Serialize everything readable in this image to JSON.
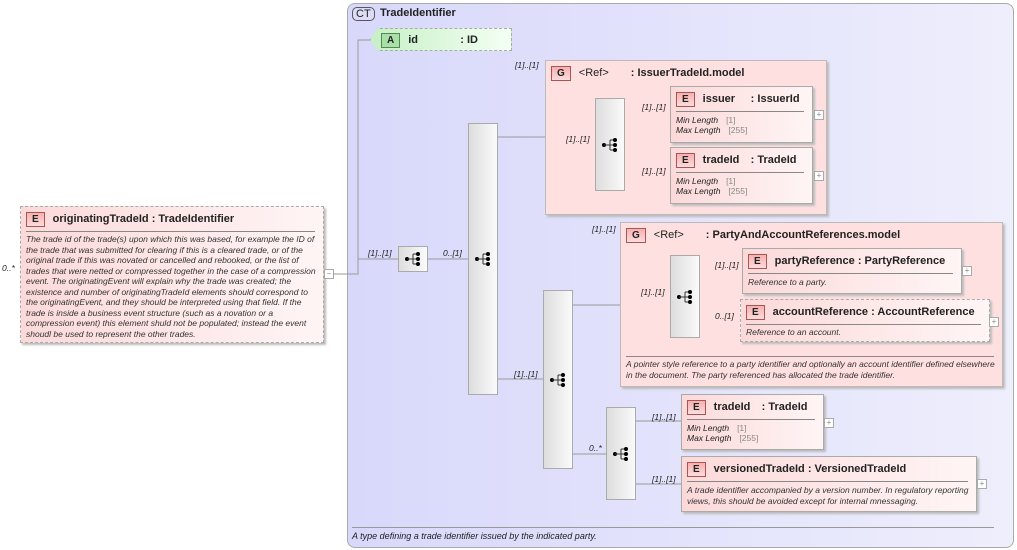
{
  "root": {
    "cardinality": "0..*",
    "badge": "E",
    "name": "originatingTradeId",
    "type": ": TradeIdentifier",
    "description": "The trade id of the trade(s) upon which this was based, for example the ID of the trade that was submitted for clearing if this is a cleared trade, or of the original trade if this was novated or cancelled and rebooked, or the list of trades that were netted or compressed together in the case of a compression event. The originatingEvent will explain why the trade was created; the existence and number of originatingTradeId elements should correspond to the originatingEvent, and they should be interpreted using that field. If the trade is inside a business event structure (such as a novation or a compression event) this element shuld not be populated; instead the event shoudl be used to represent the other trades."
  },
  "complex_type": {
    "badge": "CT",
    "name": "TradeIdentifier",
    "description": "A type defining a trade identifier issued by the indicated party."
  },
  "attribute": {
    "badge": "A",
    "name": "id",
    "type": ": ID"
  },
  "sequence_card": "[1]..[1]",
  "choice_card": "0..[1]",
  "issuer_group": {
    "card": "[1]..[1]",
    "badge": "G",
    "ref": "<Ref>",
    "name": ": IssuerTradeId.model",
    "seq_card": "[1]..[1]",
    "items": [
      {
        "card": "[1]..[1]",
        "badge": "E",
        "name": "issuer",
        "type": ": IssuerId",
        "facets": [
          [
            "Min Length",
            "[1]"
          ],
          [
            "Max Length",
            "[255]"
          ]
        ]
      },
      {
        "card": "[1]..[1]",
        "badge": "E",
        "name": "tradeId",
        "type": ": TradeId",
        "facets": [
          [
            "Min Length",
            "[1]"
          ],
          [
            "Max Length",
            "[255]"
          ]
        ]
      }
    ]
  },
  "seq2_card": "[1]..[1]",
  "party_group": {
    "card": "[1]..[1]",
    "badge": "G",
    "ref": "<Ref>",
    "name": ": PartyAndAccountReferences.model",
    "seq_card": "[1]..[1]",
    "items": [
      {
        "card": "[1]..[1]",
        "badge": "E",
        "name": "partyReference",
        "type": ": PartyReference",
        "description": "Reference to a party."
      },
      {
        "card": "0..[1]",
        "badge": "E",
        "name": "accountReference",
        "type": ": AccountReference",
        "description": "Reference to an account."
      }
    ],
    "description": "A pointer style reference to a party identifier and optionally an account identifier defined elsewhere in the document. The party referenced has allocated the trade identifier."
  },
  "choice2_card": "0..*",
  "choice2_items": [
    {
      "card": "[1]..[1]",
      "badge": "E",
      "name": "tradeId",
      "type": ": TradeId",
      "facets": [
        [
          "Min Length",
          "[1]"
        ],
        [
          "Max Length",
          "[255]"
        ]
      ]
    },
    {
      "card": "[1]..[1]",
      "badge": "E",
      "name": "versionedTradeId",
      "type": ": VersionedTradeId",
      "description": "A trade identifier accompanied by a version number. In regulatory reporting views, this should be avoided except for internal mnessaging."
    }
  ]
}
